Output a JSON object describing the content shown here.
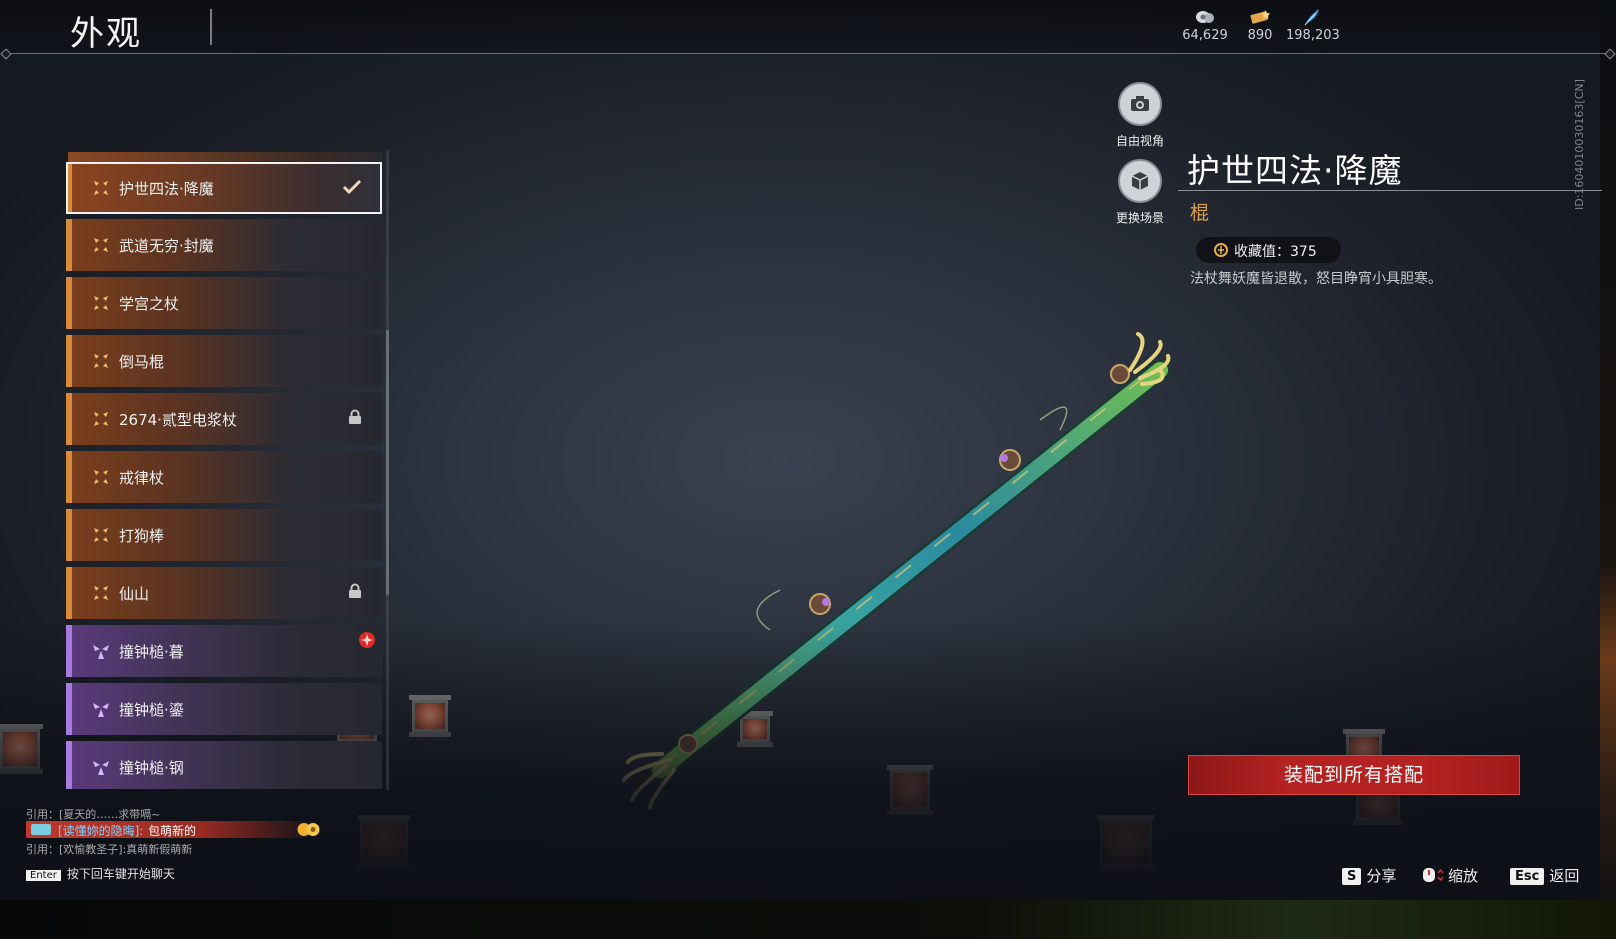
{
  "header": {
    "title": "外观",
    "currencies": [
      {
        "icon": "coin-icon",
        "value": "64,629"
      },
      {
        "icon": "ticket-icon",
        "value": "890"
      },
      {
        "icon": "feather-icon",
        "value": "198,203"
      }
    ]
  },
  "list": {
    "items": [
      {
        "name": "护世四法·降魔",
        "rarity": "orange",
        "status": "equipped"
      },
      {
        "name": "武道无穷·封魔",
        "rarity": "orange",
        "status": ""
      },
      {
        "name": "学宫之杖",
        "rarity": "orange",
        "status": ""
      },
      {
        "name": "倒马棍",
        "rarity": "orange",
        "status": ""
      },
      {
        "name": "2674·贰型电浆杖",
        "rarity": "orange",
        "status": "locked"
      },
      {
        "name": "戒律杖",
        "rarity": "orange",
        "status": ""
      },
      {
        "name": "打狗棒",
        "rarity": "orange",
        "status": ""
      },
      {
        "name": "仙山",
        "rarity": "orange",
        "status": "locked"
      },
      {
        "name": "撞钟槌·暮",
        "rarity": "purple",
        "status": "new"
      },
      {
        "name": "撞钟槌·鎏",
        "rarity": "purple",
        "status": ""
      },
      {
        "name": "撞钟槌·钢",
        "rarity": "purple",
        "status": ""
      }
    ]
  },
  "view_controls": {
    "free_camera_label": "自由视角",
    "change_scene_label": "更换场景"
  },
  "detail": {
    "title": "护世四法·降魔",
    "type": "棍",
    "collect_label": "收藏值：375",
    "description": "法杖舞妖魔皆退散，怒目睁宵小具胆寒。",
    "id": "ID:1604010030163[CN]",
    "equip_button": "装配到所有搭配"
  },
  "hotkeys": [
    {
      "key": "S",
      "label": "分享"
    },
    {
      "key": "",
      "label": "缩放"
    },
    {
      "key": "Esc",
      "label": "返回"
    }
  ],
  "chat": {
    "quote1": "引用：[夏天的……求带嗝~",
    "highlight_name": "[读懂妳的隐晦]:",
    "highlight_msg": "包萌新的",
    "quote2": "引用：[欢愉教圣子]:真萌新假萌新",
    "enter_key": "Enter",
    "enter_hint": "按下回车键开始聊天"
  },
  "colors": {
    "orange_rarity": "#d88a3a",
    "purple_rarity": "#a77ae0",
    "accent_gold": "#e0a040",
    "equip_red": "#b52222"
  }
}
